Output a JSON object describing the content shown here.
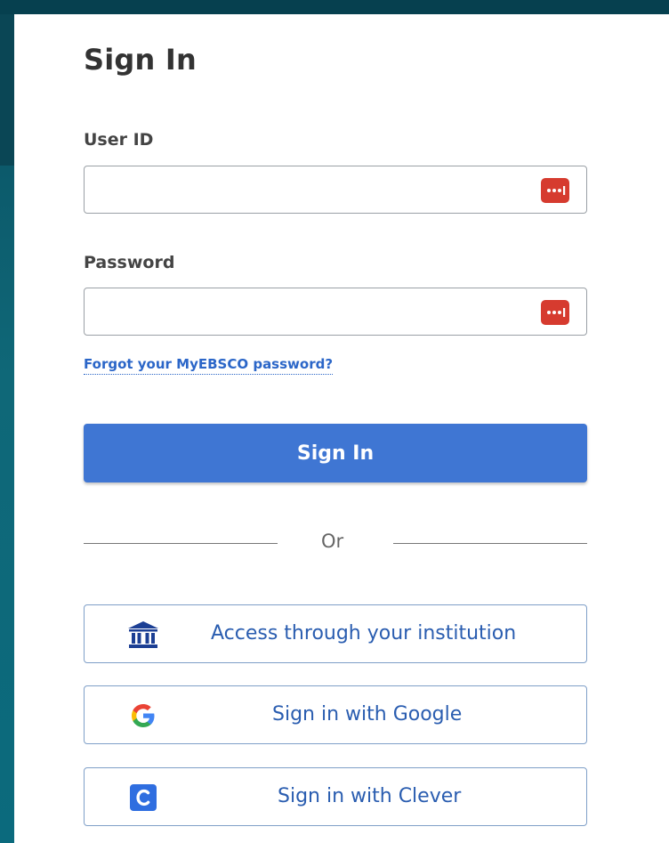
{
  "form": {
    "title": "Sign In",
    "user_id_label": "User ID",
    "user_id_value": "",
    "password_label": "Password",
    "password_value": "",
    "forgot_link": "Forgot your MyEBSCO password?",
    "submit_label": "Sign In",
    "divider_text": "Or"
  },
  "alt_signin": [
    {
      "label": "Access through your institution",
      "icon": "institution-icon"
    },
    {
      "label": "Sign in with Google",
      "icon": "google-icon"
    },
    {
      "label": "Sign in with Clever",
      "icon": "clever-icon"
    }
  ],
  "colors": {
    "primary": "#3f76d3",
    "link": "#2b66c8",
    "password_manager": "#d63b2f",
    "background": "#0b6a7d"
  }
}
